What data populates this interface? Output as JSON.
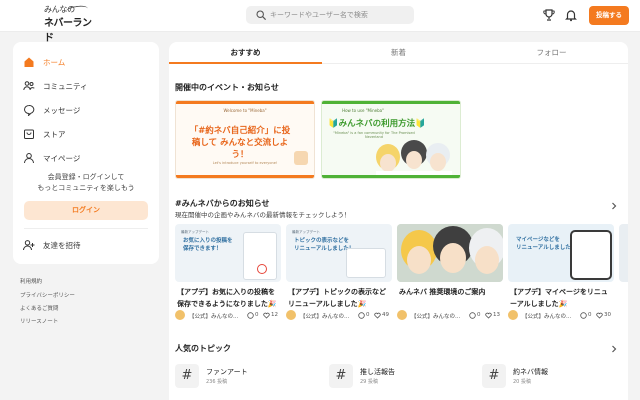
{
  "header": {
    "logo_line1": "みんなの",
    "logo_line2": "ネバーランド",
    "search_placeholder": "キーワードやユーザー名で検索",
    "post_button": "投稿する",
    "icons": [
      "trophy-icon",
      "bell-icon",
      "search-icon"
    ]
  },
  "sidebar": {
    "items": [
      {
        "label": "ホーム",
        "icon": "home-icon",
        "active": true
      },
      {
        "label": "コミュニティ",
        "icon": "people-icon",
        "active": false
      },
      {
        "label": "メッセージ",
        "icon": "chat-icon",
        "active": false
      },
      {
        "label": "ストア",
        "icon": "store-icon",
        "active": false
      },
      {
        "label": "マイページ",
        "icon": "user-icon",
        "active": false
      }
    ],
    "message_line1": "会員登録・ログインして",
    "message_line2": "もっとコミュニティを楽しもう",
    "login_button": "ログイン",
    "invite_label": "友達を招待",
    "footer_links": [
      "利用規約",
      "プライバシーポリシー",
      "よくあるご質問",
      "リリースノート"
    ]
  },
  "tabs": [
    "おすすめ",
    "新着",
    "フォロー"
  ],
  "events": {
    "title": "開催中のイベント・お知らせ",
    "banners": [
      {
        "small": "Welcome to \"Mineba\"",
        "big": "「#約ネバ自己紹介」に投稿して みんなと交流しよう！",
        "tiny": "Let's introduce yourself to everyone!"
      },
      {
        "small": "How to use \"Mineba\"",
        "big": "🔰みんネバの利用方法🔰",
        "tiny": "\"Mineba\" is a fan community for The Promised Neverland"
      }
    ]
  },
  "news": {
    "title": "#みんネバからのお知らせ",
    "subtitle": "現在開催中の企画やみんネバの最新情報をチェックしよう！",
    "cards": [
      {
        "title": "【アプデ】お気に入りの投稿を保存できるようになりました🎉",
        "author": "【公式】みんなの...",
        "comments": "0",
        "likes": "12",
        "img_label": "最新アップデート",
        "img_head": "お気に入りの投稿を\n保存できます！"
      },
      {
        "title": "【アプデ】トピックの表示などリニューアルしました🎉",
        "author": "【公式】みんなの...",
        "comments": "0",
        "likes": "49",
        "img_label": "最新アップデート",
        "img_head": "トピックの表示などを\nリニューアルしました！"
      },
      {
        "title": "みんネバ 推奨環境のご案内",
        "author": "【公式】みんなの...",
        "comments": "0",
        "likes": "13",
        "img_label": "",
        "img_head": ""
      },
      {
        "title": "【アプデ】マイページをリニューアルしました🎉",
        "author": "【公式】みんなの...",
        "comments": "0",
        "likes": "30",
        "img_label": "",
        "img_head": "マイページなどを\nリニューアルしました！"
      }
    ]
  },
  "topics": {
    "title": "人気のトピック",
    "items": [
      {
        "name": "ファンアート",
        "count": "236 投稿"
      },
      {
        "name": "推し活報告",
        "count": "29 投稿"
      },
      {
        "name": "約ネバ情報",
        "count": "20 投稿"
      }
    ]
  },
  "colors": {
    "accent": "#f47a1f",
    "accent_light": "#fde6d2",
    "background": "#f3f3f3"
  }
}
